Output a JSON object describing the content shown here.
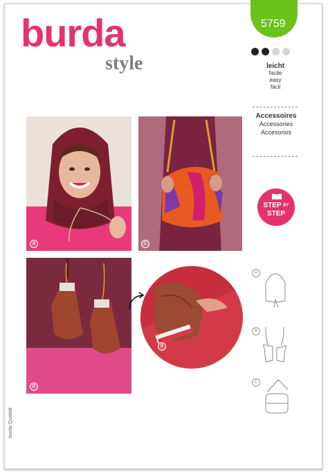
{
  "pattern_number": "5759",
  "brand": {
    "name": "burda",
    "sub": "style",
    "color": "#e5326e",
    "badge_color": "#6cc21a"
  },
  "difficulty": {
    "level_dots": 2,
    "total_dots": 4,
    "main": "leicht",
    "translations": [
      "facile",
      "easy",
      "fácil"
    ]
  },
  "category": {
    "main": "Accessoires",
    "translations": [
      "Accessories",
      "Accesorios"
    ]
  },
  "step_badge": {
    "line1_a": "STEP",
    "line1_b": "BY",
    "line2": "STEP"
  },
  "views": [
    {
      "letter": "A",
      "icon": "hood-photo"
    },
    {
      "letter": "C",
      "icon": "fur-bag-photo"
    },
    {
      "letter": "B",
      "icon": "mittens-photo"
    },
    {
      "letter": "B",
      "icon": "mitten-detail-photo"
    }
  ],
  "sketches": [
    {
      "letter": "A",
      "icon": "hood-sketch-icon"
    },
    {
      "letter": "B",
      "icon": "mittens-sketch-icon"
    },
    {
      "letter": "C",
      "icon": "bag-sketch-icon"
    }
  ],
  "quality_label": "burda Qualität"
}
